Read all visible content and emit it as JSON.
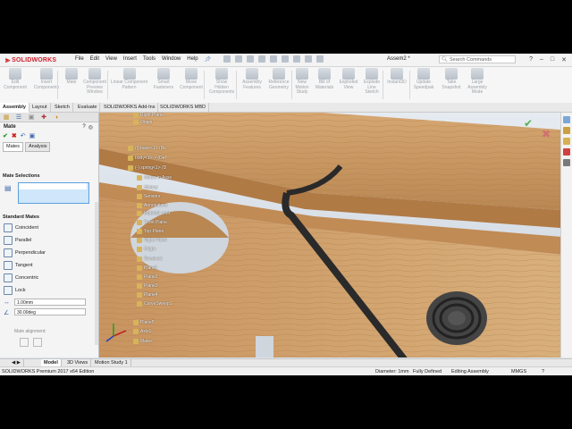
{
  "app": {
    "logo": "SOLIDWORKS",
    "document_title": "Assem2 *"
  },
  "menu": [
    "File",
    "Edit",
    "View",
    "Insert",
    "Tools",
    "Window",
    "Help"
  ],
  "search": {
    "placeholder": "Search Commands"
  },
  "commands": [
    "Edit\nComponent",
    "Insert\nComponents",
    "Mate",
    "Component\nPreview\nWindow",
    "Linear Component\nPattern",
    "Smart\nFasteners",
    "Move\nComponent",
    "Show\nHidden\nComponents",
    "Assembly\nFeatures",
    "Reference\nGeometry",
    "New\nMotion\nStudy",
    "Bill of\nMaterials",
    "Exploded\nView",
    "Explode\nLine\nSketch",
    "Instant3D",
    "Update\nSpeedpak",
    "Take\nSnapshot",
    "Large\nAssembly\nMode"
  ],
  "tabs": [
    "Assembly",
    "Layout",
    "Sketch",
    "Evaluate",
    "SOLIDWORKS Add-Ins",
    "SOLIDWORKS MBD"
  ],
  "active_tab": "Assembly",
  "property_manager": {
    "title": "Mate",
    "subtabs": [
      "Mates",
      "Analysis"
    ],
    "mate_selections_label": "Mate Selections",
    "standard_mates_label": "Standard Mates",
    "standard_mates": [
      "Coincident",
      "Parallel",
      "Perpendicular",
      "Tangent",
      "Concentric",
      "Lock"
    ],
    "distance_value": "1.00mm",
    "angle_value": "30.00deg",
    "mate_alignment_label": "Mate alignment:"
  },
  "feature_tree": [
    "Right Plane",
    "Origin",
    "(f) base<1> (De",
    "body<1>-> (Def",
    "(-) spring<1> (D",
    "Mates in Asse",
    "History",
    "Sensors",
    "Annotations",
    "Material <not",
    "Front Plane",
    "Top Plane",
    "Right Plane",
    "Origin",
    "Revolve1",
    "Plane1",
    "Plane2",
    "Plane3",
    "Plane4",
    "CurveSweep1",
    "Plane5",
    "Axis1",
    "Mates"
  ],
  "bottom_tabs": [
    "Model",
    "3D Views",
    "Motion Study 1"
  ],
  "status": {
    "edition": "SOLIDWORKS Premium 2017 x64 Edition",
    "diameter": "Diameter: 1mm",
    "definition": "Fully Defined",
    "mode": "Editing Assembly",
    "units": "MMGS"
  },
  "colors": {
    "accent_red": "#d0202a",
    "wood": "#c79a63",
    "spring": "#2b2b2b"
  }
}
